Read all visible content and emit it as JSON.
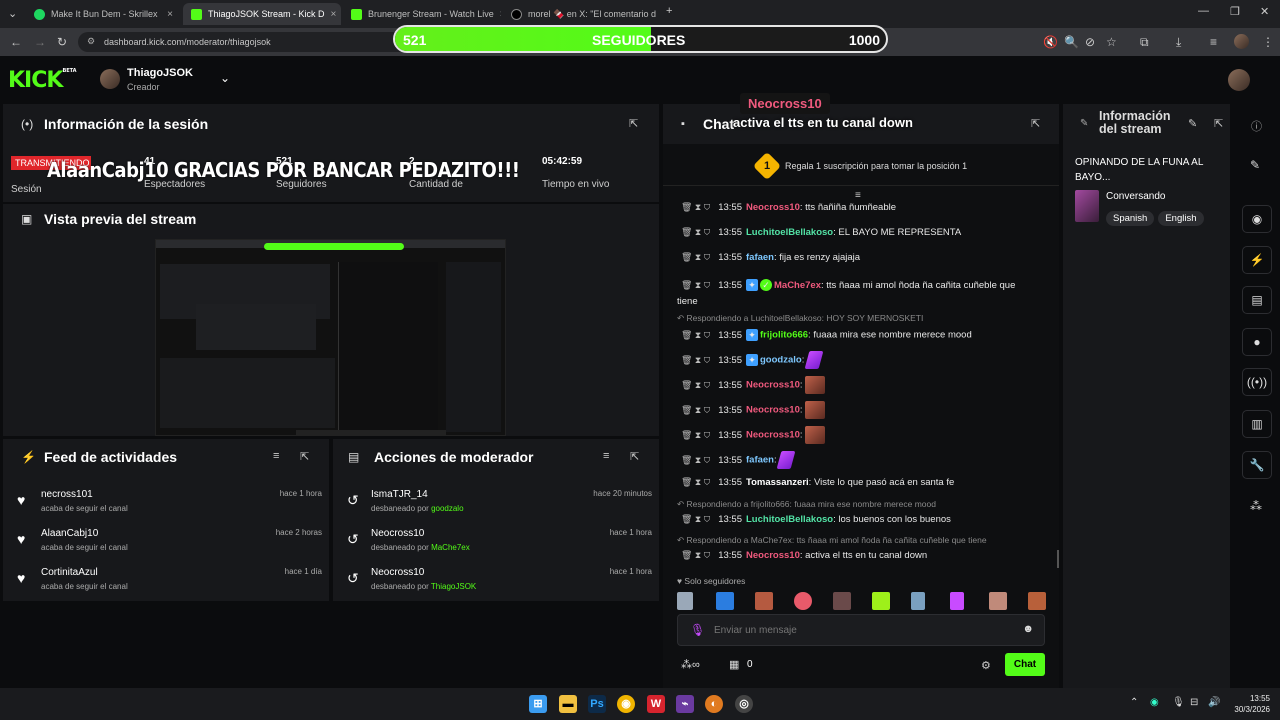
{
  "browser": {
    "tabs": [
      {
        "title": "Make It Bun Dem - Skrillex",
        "icon_color": "#1ed760"
      },
      {
        "title": "ThiagoJSOK Stream - Kick D",
        "icon_color": "#53fc18"
      },
      {
        "title": "Brunenger Stream - Watch Live",
        "icon_color": "#53fc18"
      },
      {
        "title": "morel 🍫 en X: \"El comentario d",
        "icon_color": "#ffffff"
      }
    ],
    "url": "dashboard.kick.com/moderator/thiagojsok"
  },
  "follower_goal": {
    "current": "521",
    "label": "SEGUIDORES",
    "target": "1000",
    "progress": 0.521
  },
  "header": {
    "logo": "KICK",
    "logo_badge": "BETA",
    "channel_name": "ThiagoJSOK",
    "role": "Creador"
  },
  "session": {
    "title": "Información de la sesión",
    "live_badge": "TRANSMITIENDO",
    "overlay_text": "AlaanCabj10 GRACIAS POR BANCAR PEDAZITO!!!",
    "session_label": "Sesión",
    "stats": [
      {
        "value": "41",
        "label": "Espectadores"
      },
      {
        "value": "521",
        "label": "Seguidores"
      },
      {
        "value": "2",
        "label": "Cantidad de"
      },
      {
        "value": "05:42:59",
        "label": "Tiempo en vivo"
      }
    ]
  },
  "preview": {
    "title": "Vista previa del stream"
  },
  "feed": {
    "title": "Feed de actividades",
    "items": [
      {
        "name": "necross101",
        "desc": "acaba de seguir el canal",
        "time": "hace 1 hora"
      },
      {
        "name": "AlaanCabj10",
        "desc": "acaba de seguir el canal",
        "time": "hace 2 horas"
      },
      {
        "name": "CortinitaAzul",
        "desc": "acaba de seguir el canal",
        "time": "hace 1 día"
      }
    ]
  },
  "mod_actions": {
    "title": "Acciones de moderador",
    "items": [
      {
        "name": "IsmaTJR_14",
        "desc": "desbaneado por",
        "by": "goodzalo",
        "time": "hace 20 minutos"
      },
      {
        "name": "Neocross10",
        "desc": "desbaneado por",
        "by": "MaChe7ex",
        "time": "hace 1 hora"
      },
      {
        "name": "Neocross10",
        "desc": "desbaneado por",
        "by": "ThiagoJSOK",
        "time": "hace 1 hora"
      }
    ]
  },
  "tts_alert": {
    "user": "Neocross10",
    "text": "activa el tts en tu canal down"
  },
  "chat": {
    "title": "Chat",
    "pinned": {
      "rank": "1",
      "text": "Regala 1 suscripción para tomar la posición 1"
    },
    "messages": [
      {
        "time": "13:55",
        "user": "Neocross10",
        "color": "#f05a7e",
        "text": "tts ñañiña ñumñeable"
      },
      {
        "time": "13:55",
        "user": "LuchitoelBellakoso",
        "color": "#53e3a6",
        "text": "EL BAYO ME REPRESENTA"
      },
      {
        "time": "13:55",
        "user": "fafaen",
        "color": "#7ec8ff",
        "text": "fija es renzy ajajaja"
      },
      {
        "time": "13:55",
        "user": "MaChe7ex",
        "color": "#f05a7e",
        "text": "tts ñaaa mi amol ñoda ña cañita cuñeble que",
        "text2": "tiene"
      },
      {
        "time": "13:55",
        "user": "frijolito666",
        "color": "#53fc18",
        "text": "fuaaa mira ese nombre merece mood",
        "reply": "Respondiendo a LuchitoelBellakoso: HOY SOY MERNOSKETI"
      },
      {
        "time": "13:55",
        "user": "goodzalo",
        "color": "#7ec8ff",
        "text": ""
      },
      {
        "time": "13:55",
        "user": "Neocross10",
        "color": "#f05a7e",
        "text": ""
      },
      {
        "time": "13:55",
        "user": "Neocross10",
        "color": "#f05a7e",
        "text": ""
      },
      {
        "time": "13:55",
        "user": "Neocross10",
        "color": "#f05a7e",
        "text": ""
      },
      {
        "time": "13:55",
        "user": "fafaen",
        "color": "#7ec8ff",
        "text": ""
      },
      {
        "time": "13:55",
        "user": "Tomassanzeri",
        "color": "#ffffff",
        "text": "Viste lo que pasó acá en santa fe"
      },
      {
        "time": "13:55",
        "user": "LuchitoelBellakoso",
        "color": "#53e3a6",
        "text": "los buenos con los buenos",
        "reply": "Respondiendo a frijolito666: fuaaa mira ese nombre merece mood"
      },
      {
        "time": "13:55",
        "user": "Neocross10",
        "color": "#f05a7e",
        "text": "activa el tts en tu canal down",
        "reply": "Respondiendo a MaChe7ex: tts ñaaa mi amol ñoda ña cañita cuñeble que tiene"
      }
    ],
    "followers_only": "Solo seguidores",
    "input_placeholder": "Enviar un mensaje",
    "bottom_count": "0",
    "send_label": "Chat"
  },
  "stream_info": {
    "title": "Información del stream",
    "stream_title": "OPINANDO DE LA FUNA AL BAYO...",
    "category": "Conversando",
    "tags": [
      "Spanish",
      "English"
    ]
  },
  "taskbar": {
    "time": "13:55",
    "date": "30/3/2026"
  },
  "colors": {
    "accent": "#53fc18",
    "panel": "#17181b",
    "bg": "#0b0c0e"
  }
}
